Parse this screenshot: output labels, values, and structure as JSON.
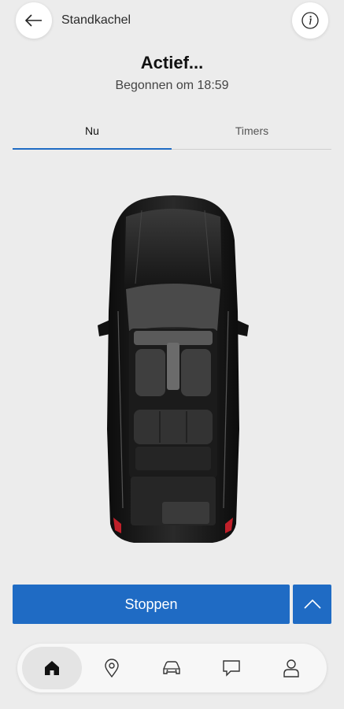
{
  "header": {
    "title": "Standkachel",
    "back_icon": "arrow-left-icon",
    "info_icon": "info-icon"
  },
  "status": {
    "title": "Actief...",
    "subtitle": "Begonnen om 18:59"
  },
  "tabs": [
    {
      "label": "Nu",
      "active": true
    },
    {
      "label": "Timers",
      "active": false
    }
  ],
  "actions": {
    "primary_label": "Stoppen",
    "expand_icon": "chevron-up-icon"
  },
  "bottom_nav": [
    {
      "icon": "home-icon",
      "active": true
    },
    {
      "icon": "location-pin-icon",
      "active": false
    },
    {
      "icon": "car-icon",
      "active": false
    },
    {
      "icon": "chat-icon",
      "active": false
    },
    {
      "icon": "profile-icon",
      "active": false
    }
  ],
  "colors": {
    "accent": "#1f6bc4",
    "background": "#ececec",
    "car_body": "#141414",
    "tail_light": "#c0202a"
  }
}
